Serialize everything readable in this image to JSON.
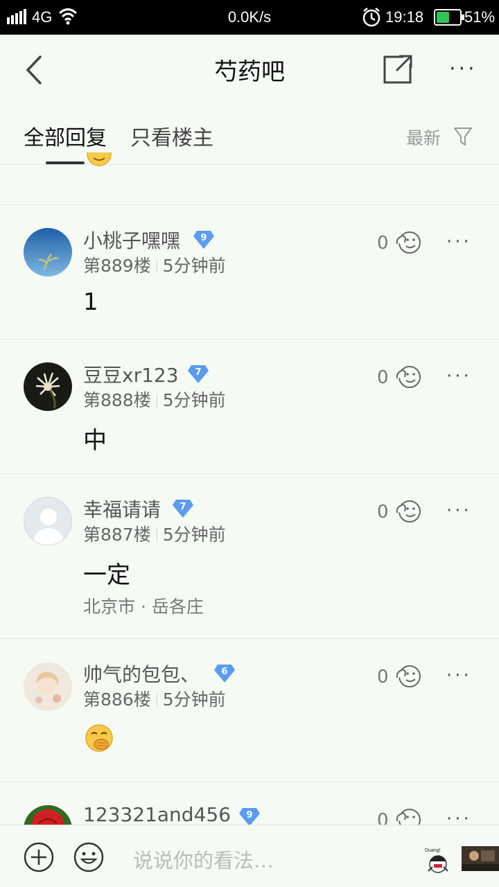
{
  "status_bar": {
    "network": "4G",
    "speed": "0.0K/s",
    "time": "19:18",
    "battery": "51%",
    "battery_level": 0.51,
    "battery_color": "#2fc45a"
  },
  "header": {
    "title": "芍药吧",
    "icons": [
      "back-arrow-icon",
      "share-icon",
      "more-icon"
    ]
  },
  "tabs": {
    "all_replies": "全部回复",
    "only_op": "只看楼主",
    "sort": "最新"
  },
  "posts": [
    {
      "username": "小桃子嘿嘿",
      "level": "9",
      "floor": "第889楼",
      "time": "5分钟前",
      "content": "1",
      "likes": "0"
    },
    {
      "username": "豆豆xr123",
      "level": "7",
      "floor": "第888楼",
      "time": "5分钟前",
      "content": "中",
      "likes": "0"
    },
    {
      "username": "幸福请请",
      "level": "7",
      "floor": "第887楼",
      "time": "5分钟前",
      "content": "一定",
      "location": "北京市 · 岳各庄",
      "likes": "0"
    },
    {
      "username": "帅气的包包、",
      "level": "6",
      "floor": "第886楼",
      "time": "5分钟前",
      "content_icon": "covering-mouth-emoji-icon",
      "likes": "0"
    },
    {
      "username": "123321and456",
      "level": "9",
      "likes": "0"
    }
  ],
  "bottom_bar": {
    "placeholder": "说说你的看法…",
    "sticker_caption": "Duang!"
  },
  "colors": {
    "badge": "#5b9cf0",
    "background": "#f5faf5"
  }
}
